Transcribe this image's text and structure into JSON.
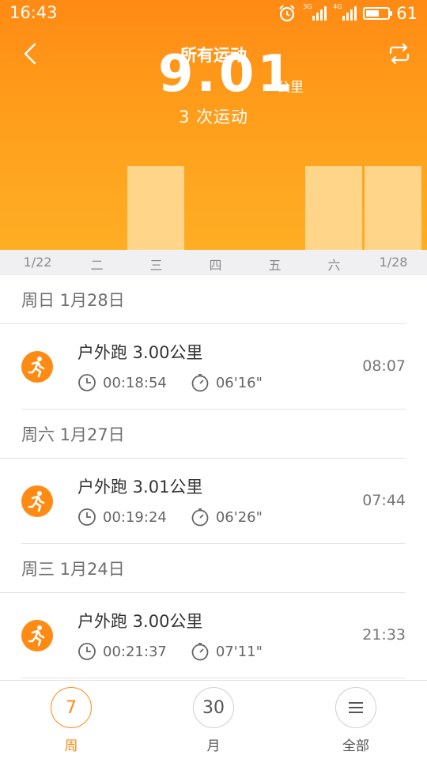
{
  "status_bar": {
    "time": "16:43",
    "signal_tags": [
      "3G",
      "4G"
    ],
    "battery": "61",
    "battery_level": 0.61
  },
  "nav": {
    "title": "所有运动",
    "back_icon": "chevron-left-icon",
    "switch_icon": "swap-icon"
  },
  "summary": {
    "value": "9.01",
    "unit": "公里",
    "count_text": "3 次运动"
  },
  "chart_data": {
    "type": "bar",
    "categories": [
      "1/22",
      "二",
      "三",
      "四",
      "五",
      "六",
      "1/28"
    ],
    "values": [
      0,
      0,
      3.0,
      0,
      0,
      3.01,
      3.0
    ]
  },
  "days": [
    {
      "header": "周日 1月28日",
      "items": [
        {
          "title": "户外跑 3.00公里",
          "duration": "00:18:54",
          "pace": "06'16\"",
          "time": "08:07"
        }
      ]
    },
    {
      "header": "周六 1月27日",
      "items": [
        {
          "title": "户外跑 3.01公里",
          "duration": "00:19:24",
          "pace": "06'26\"",
          "time": "07:44"
        }
      ]
    },
    {
      "header": "周三 1月24日",
      "items": [
        {
          "title": "户外跑 3.00公里",
          "duration": "00:21:37",
          "pace": "07'11\"",
          "time": "21:33"
        }
      ]
    }
  ],
  "tabs": [
    {
      "icon_text": "7",
      "label": "周",
      "active": true
    },
    {
      "icon_text": "30",
      "label": "月",
      "active": false
    },
    {
      "icon_text": "",
      "label": "全部",
      "active": false
    }
  ],
  "colors": {
    "accent": "#ff8a14",
    "bar": "#ffd58a"
  }
}
